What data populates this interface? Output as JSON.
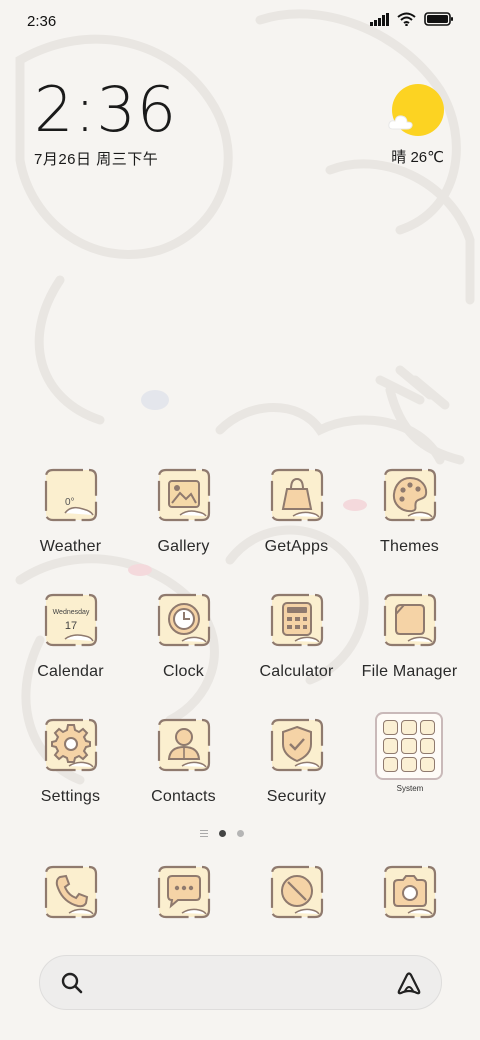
{
  "status_bar": {
    "time": "2:36",
    "icons": [
      "signal-icon",
      "wifi-icon",
      "battery-icon"
    ]
  },
  "clock_widget": {
    "time": "2:36",
    "date": "7月26日 周三下午"
  },
  "weather_widget": {
    "text": "晴 26℃",
    "icon": "sun-cloud-icon"
  },
  "apps": [
    {
      "label": "Weather",
      "icon": "weather-icon",
      "icon_text": "0°"
    },
    {
      "label": "Gallery",
      "icon": "gallery-icon"
    },
    {
      "label": "GetApps",
      "icon": "shopping-bag-icon"
    },
    {
      "label": "Themes",
      "icon": "palette-icon"
    },
    {
      "label": "Calendar",
      "icon": "calendar-icon",
      "icon_text": "Wednesday",
      "icon_number": "17"
    },
    {
      "label": "Clock",
      "icon": "clock-icon"
    },
    {
      "label": "Calculator",
      "icon": "calculator-icon"
    },
    {
      "label": "File Manager",
      "icon": "folder-icon"
    },
    {
      "label": "Settings",
      "icon": "gear-icon"
    },
    {
      "label": "Contacts",
      "icon": "person-icon"
    },
    {
      "label": "Security",
      "icon": "shield-check-icon"
    }
  ],
  "folder": {
    "label": "System",
    "icon": "folder-grid-icon"
  },
  "page_indicator": {
    "pages": 2,
    "current": 1
  },
  "dock": [
    {
      "icon": "phone-icon"
    },
    {
      "icon": "message-icon"
    },
    {
      "icon": "browser-icon"
    },
    {
      "icon": "camera-icon"
    }
  ],
  "search_bar": {
    "icon": "search-icon",
    "assistant_icon": "assistant-icon"
  },
  "colors": {
    "icon_fill": "#fbefcf",
    "icon_stroke": "#8f7a6e",
    "sun": "#fcd322",
    "text": "#2a2a2a"
  }
}
